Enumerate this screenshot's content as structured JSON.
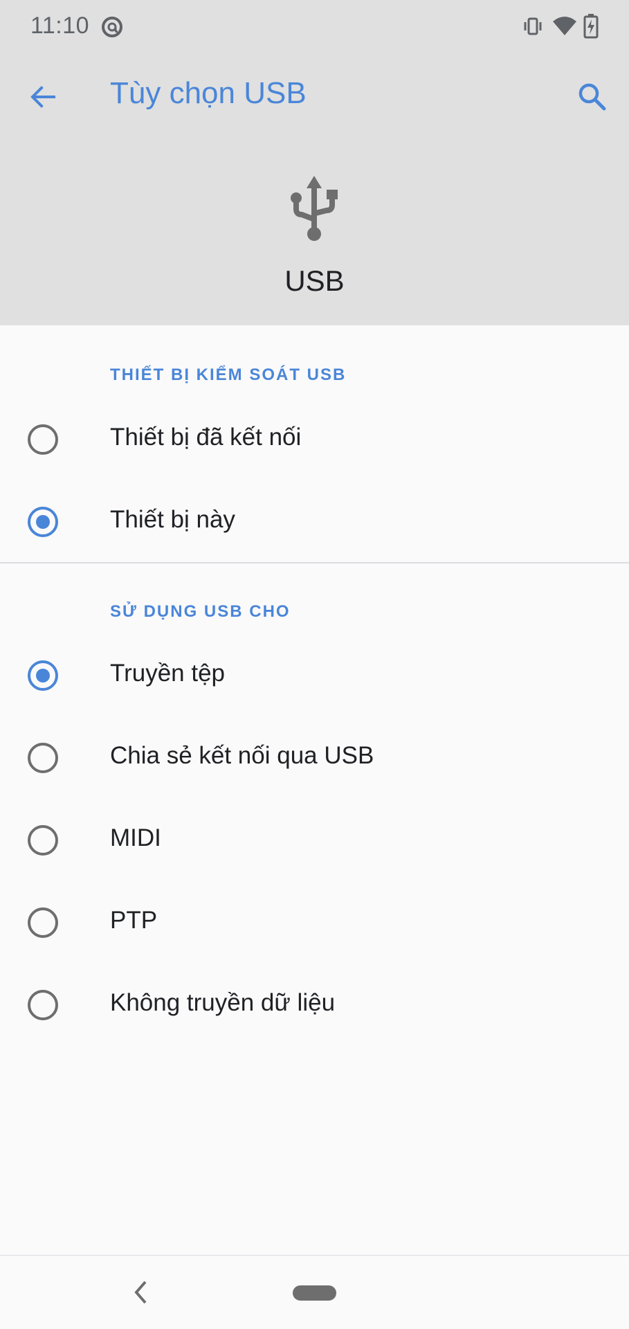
{
  "status_bar": {
    "time": "11:10",
    "icons": [
      "at-sign-icon",
      "vibrate-icon",
      "wifi-icon",
      "battery-charging-icon"
    ]
  },
  "app_bar": {
    "title": "Tùy chọn USB",
    "back_icon": "arrow-back-icon",
    "search_icon": "search-icon"
  },
  "hero": {
    "icon": "usb-icon",
    "label": "USB"
  },
  "sections": [
    {
      "header": "THIẾT BỊ KIỂM SOÁT USB",
      "options": [
        {
          "label": "Thiết bị đã kết nối",
          "selected": false
        },
        {
          "label": "Thiết bị này",
          "selected": true
        }
      ]
    },
    {
      "header": "SỬ DỤNG USB CHO",
      "options": [
        {
          "label": "Truyền tệp",
          "selected": true
        },
        {
          "label": "Chia sẻ kết nối qua USB",
          "selected": false
        },
        {
          "label": "MIDI",
          "selected": false
        },
        {
          "label": "PTP",
          "selected": false
        },
        {
          "label": "Không truyền dữ liệu",
          "selected": false
        }
      ]
    }
  ],
  "colors": {
    "accent": "#4a86d8",
    "header_bg": "#e0e0e0",
    "page_bg": "#fafafa",
    "text": "#202124",
    "icon_gray": "#6e6e6e"
  },
  "nav_bar": {
    "back_icon": "nav-back-icon",
    "home_icon": "home-pill-icon"
  }
}
